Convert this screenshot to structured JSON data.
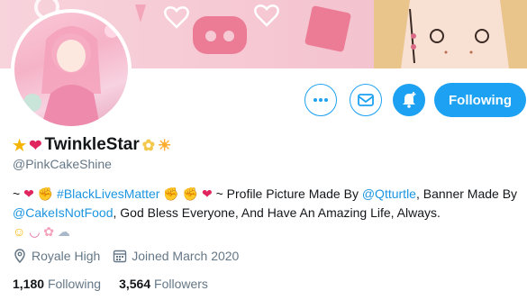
{
  "profile": {
    "name": "TwinkleStar",
    "handle": "@PinkCakeShine",
    "name_prefix_icons": [
      "star-icon",
      "red-heart-icon"
    ],
    "name_suffix_icons": [
      "blossom-icon",
      "sun-icon"
    ]
  },
  "actions": {
    "more_icon": "more-icon",
    "message_icon": "envelope-icon",
    "notify_icon": "bell-plus-icon",
    "follow_label": "Following"
  },
  "bio": {
    "line1_prefix": "~",
    "hashtag": "#BlackLivesMatter",
    "middle": " ~ Profile Picture Made By ",
    "mention1": "@Qtturtle",
    "mid2": ", Banner Made By ",
    "mention2": "@CakeIsNotFood",
    "ending": ", God Bless Everyone, And Have An Amazing Life, Always."
  },
  "meta": {
    "location": "Royale High",
    "joined": "Joined March 2020"
  },
  "stats": {
    "following_count": "1,180",
    "following_label": "Following",
    "followers_count": "3,564",
    "followers_label": "Followers"
  },
  "colors": {
    "accent": "#1da1f2",
    "link": "#1b95e0",
    "muted": "#657786",
    "banner_pink": "#f6c9d4"
  }
}
